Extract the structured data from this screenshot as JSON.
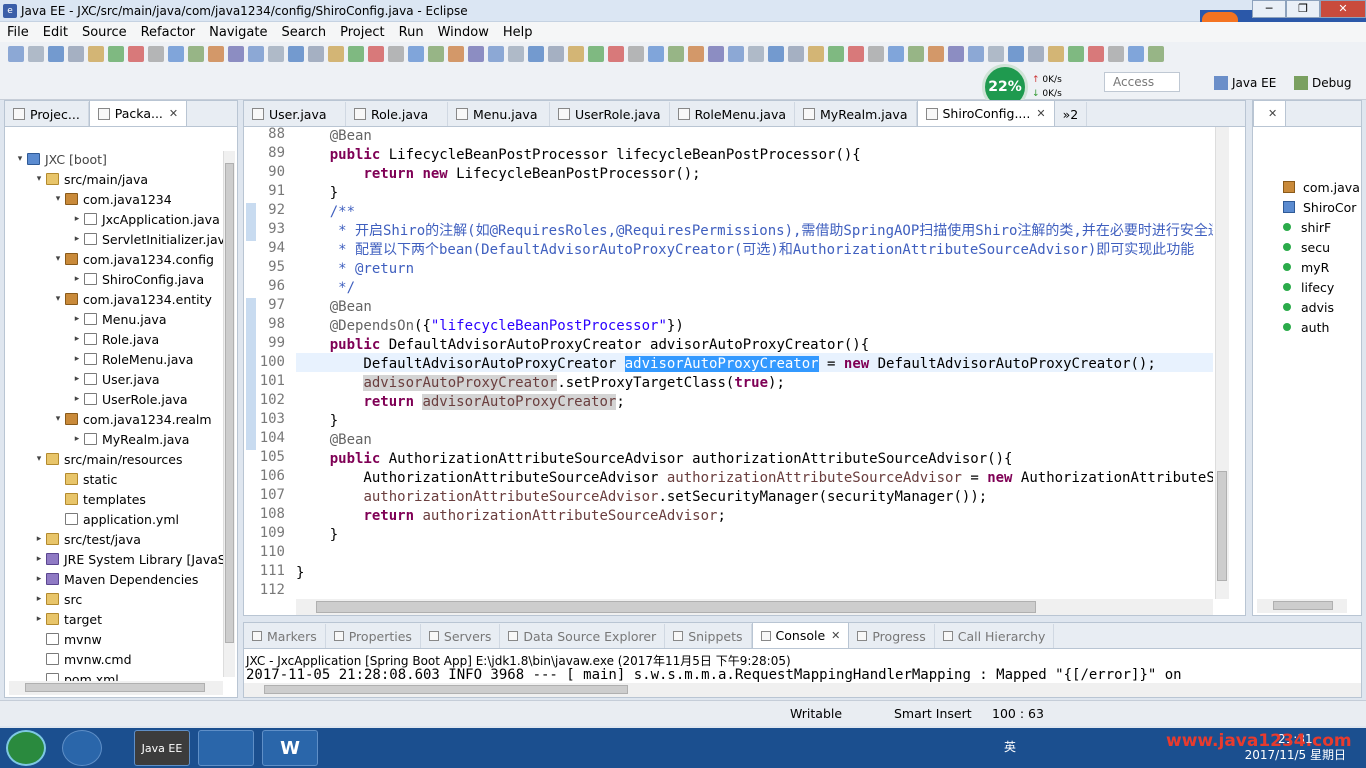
{
  "window": {
    "title": "Java EE - JXC/src/main/java/com/java1234/config/ShiroConfig.java - Eclipse",
    "min": "─",
    "max": "❐",
    "close": "✕"
  },
  "menu": [
    "File",
    "Edit",
    "Source",
    "Refactor",
    "Navigate",
    "Search",
    "Project",
    "Run",
    "Window",
    "Help"
  ],
  "toolbar": {
    "cpu_percent": "22%",
    "net_up": "0K/s",
    "net_down": "0K/s",
    "quick_access": "Access",
    "perspective_javaee": "Java EE",
    "perspective_debug": "Debug"
  },
  "ime": {
    "lang": "英",
    "moon": "☾",
    "dot": "•"
  },
  "left_panel": {
    "tab1": "Projec...",
    "tab2": "Packa...",
    "tree": [
      {
        "label": "JXC [boot]",
        "level": 0,
        "icon": "proj",
        "arrow": "▾"
      },
      {
        "label": "src/main/java",
        "level": 1,
        "icon": "fold",
        "arrow": "▾"
      },
      {
        "label": "com.java1234",
        "level": 2,
        "icon": "pkg",
        "arrow": "▾"
      },
      {
        "label": "JxcApplication.java",
        "level": 3,
        "icon": "java",
        "arrow": "▸"
      },
      {
        "label": "ServletInitializer.java",
        "level": 3,
        "icon": "java",
        "arrow": "▸"
      },
      {
        "label": "com.java1234.config",
        "level": 2,
        "icon": "pkg",
        "arrow": "▾"
      },
      {
        "label": "ShiroConfig.java",
        "level": 3,
        "icon": "java",
        "arrow": "▸"
      },
      {
        "label": "com.java1234.entity",
        "level": 2,
        "icon": "pkg",
        "arrow": "▾"
      },
      {
        "label": "Menu.java",
        "level": 3,
        "icon": "java",
        "arrow": "▸"
      },
      {
        "label": "Role.java",
        "level": 3,
        "icon": "java",
        "arrow": "▸"
      },
      {
        "label": "RoleMenu.java",
        "level": 3,
        "icon": "java",
        "arrow": "▸"
      },
      {
        "label": "User.java",
        "level": 3,
        "icon": "java",
        "arrow": "▸"
      },
      {
        "label": "UserRole.java",
        "level": 3,
        "icon": "java",
        "arrow": "▸"
      },
      {
        "label": "com.java1234.realm",
        "level": 2,
        "icon": "pkg",
        "arrow": "▾"
      },
      {
        "label": "MyRealm.java",
        "level": 3,
        "icon": "java",
        "arrow": "▸"
      },
      {
        "label": "src/main/resources",
        "level": 1,
        "icon": "fold",
        "arrow": "▾"
      },
      {
        "label": "static",
        "level": 2,
        "icon": "fold",
        "arrow": ""
      },
      {
        "label": "templates",
        "level": 2,
        "icon": "fold",
        "arrow": ""
      },
      {
        "label": "application.yml",
        "level": 2,
        "icon": "java",
        "arrow": ""
      },
      {
        "label": "src/test/java",
        "level": 1,
        "icon": "fold",
        "arrow": "▸"
      },
      {
        "label": "JRE System Library [JavaS",
        "level": 1,
        "icon": "lib",
        "arrow": "▸"
      },
      {
        "label": "Maven Dependencies",
        "level": 1,
        "icon": "lib",
        "arrow": "▸"
      },
      {
        "label": "src",
        "level": 1,
        "icon": "fold",
        "arrow": "▸"
      },
      {
        "label": "target",
        "level": 1,
        "icon": "fold",
        "arrow": "▸"
      },
      {
        "label": "mvnw",
        "level": 1,
        "icon": "java",
        "arrow": ""
      },
      {
        "label": "mvnw.cmd",
        "level": 1,
        "icon": "java",
        "arrow": ""
      },
      {
        "label": "pom.xml",
        "level": 1,
        "icon": "java",
        "arrow": ""
      }
    ]
  },
  "editor": {
    "tabs": [
      "User.java",
      "Role.java",
      "Menu.java",
      "UserRole.java",
      "RoleMenu.java",
      "MyRealm.java",
      "ShiroConfig...."
    ],
    "overflow": "»2",
    "active_tab": 6,
    "lines": [
      {
        "n": "88",
        "html": "    <span class='ann'>@Bean</span>"
      },
      {
        "n": "89",
        "html": "    <span class='kw'>public</span> LifecycleBeanPostProcessor lifecycleBeanPostProcessor(){"
      },
      {
        "n": "90",
        "html": "        <span class='kw'>return</span> <span class='kw'>new</span> LifecycleBeanPostProcessor();"
      },
      {
        "n": "91",
        "html": "    }"
      },
      {
        "n": "92",
        "html": "    <span class='cm'>/**</span>"
      },
      {
        "n": "93",
        "html": "<span class='cm'>     * 开启Shiro的注解(如@RequiresRoles,@RequiresPermissions),需借助SpringAOP扫描使用Shiro注解的类,并在必要时进行安全逻辑</span>"
      },
      {
        "n": "94",
        "html": "<span class='cm'>     * 配置以下两个bean(DefaultAdvisorAutoProxyCreator(可选)和AuthorizationAttributeSourceAdvisor)即可实现此功能</span>"
      },
      {
        "n": "95",
        "html": "<span class='cm'>     * @return</span>"
      },
      {
        "n": "96",
        "html": "<span class='cm'>     */</span>"
      },
      {
        "n": "97",
        "html": "    <span class='ann'>@Bean</span>"
      },
      {
        "n": "98",
        "html": "    <span class='ann'>@DependsOn</span>({<span class='str'>\"lifecycleBeanPostProcessor\"</span>})"
      },
      {
        "n": "99",
        "html": "    <span class='kw'>public</span> DefaultAdvisorAutoProxyCreator advisorAutoProxyCreator(){"
      },
      {
        "n": "100",
        "html": "        DefaultAdvisorAutoProxyCreator <span class='sel'>advisorAutoProxyCreator</span> = <span class='kw'>new</span> DefaultAdvisorAutoProxyCreator();"
      },
      {
        "n": "101",
        "html": "        <span class='fld hl'>advisorAutoProxyCreator</span>.setProxyTargetClass(<span class='kw'>true</span>);"
      },
      {
        "n": "102",
        "html": "        <span class='kw'>return</span> <span class='fld hl'>advisorAutoProxyCreator</span>;"
      },
      {
        "n": "103",
        "html": "    }"
      },
      {
        "n": "104",
        "html": "    <span class='ann'>@Bean</span>"
      },
      {
        "n": "105",
        "html": "    <span class='kw'>public</span> AuthorizationAttributeSourceAdvisor authorizationAttributeSourceAdvisor(){"
      },
      {
        "n": "106",
        "html": "        AuthorizationAttributeSourceAdvisor <span class='fld'>authorizationAttributeSourceAdvisor</span> = <span class='kw'>new</span> AuthorizationAttributeSourceAdvisor();"
      },
      {
        "n": "107",
        "html": "        <span class='fld'>authorizationAttributeSourceAdvisor</span>.setSecurityManager(securityManager());"
      },
      {
        "n": "108",
        "html": "        <span class='kw'>return</span> <span class='fld'>authorizationAttributeSourceAdvisor</span>;"
      },
      {
        "n": "109",
        "html": "    }"
      },
      {
        "n": "110",
        "html": ""
      },
      {
        "n": "111",
        "html": "}"
      },
      {
        "n": "112",
        "html": ""
      }
    ]
  },
  "outline": {
    "items": [
      {
        "label": "com.java",
        "icon": "pkg"
      },
      {
        "label": "ShiroCor",
        "icon": "class"
      },
      {
        "label": "shirF",
        "icon": "dot"
      },
      {
        "label": "secu",
        "icon": "dot"
      },
      {
        "label": "myR",
        "icon": "dot"
      },
      {
        "label": "lifecy",
        "icon": "dot"
      },
      {
        "label": "advis",
        "icon": "dot"
      },
      {
        "label": "auth",
        "icon": "dot"
      }
    ]
  },
  "console": {
    "tabs": [
      "Markers",
      "Properties",
      "Servers",
      "Data Source Explorer",
      "Snippets",
      "Console",
      "Progress",
      "Call Hierarchy"
    ],
    "active_tab": 5,
    "header": "JXC - JxcApplication [Spring Boot App] E:\\jdk1.8\\bin\\javaw.exe (2017年11月5日 下午9:28:05)",
    "log_line": "2017-11-05 21:28:08.603  INFO 3968 --- [           main] s.w.s.m.m.a.RequestMappingHandlerMapping : Mapped \"{[/error]}\" on"
  },
  "status": {
    "writable": "Writable",
    "insert": "Smart Insert",
    "position": "100 : 63"
  },
  "taskbar": {
    "app1": "Java EE",
    "app2": "",
    "app3": "W",
    "tray_lang": "英",
    "time": "21:31",
    "date": "2017/11/5 星期日",
    "watermark": "www.java1234.com"
  }
}
